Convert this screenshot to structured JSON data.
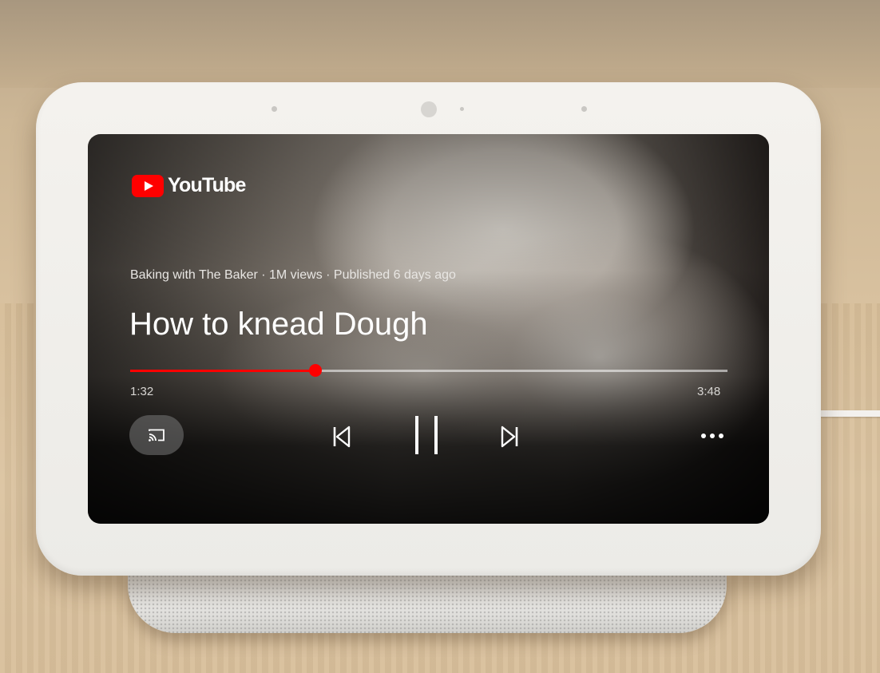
{
  "video": {
    "brand": "YouTube",
    "meta": "Baking with The Baker · 1M views · Published 6 days ago",
    "title": "How to knead Dough",
    "current_time": "1:32",
    "duration": "3:48",
    "progress": 0.31
  },
  "controls": {
    "cast_icon": "cast-icon",
    "previous_icon": "skip-previous-icon",
    "pause_icon": "pause-icon",
    "next_icon": "skip-next-icon",
    "more_icon": "more-horizontal-icon"
  },
  "colors": {
    "accent": "#ff0000",
    "text": "#ffffff"
  }
}
